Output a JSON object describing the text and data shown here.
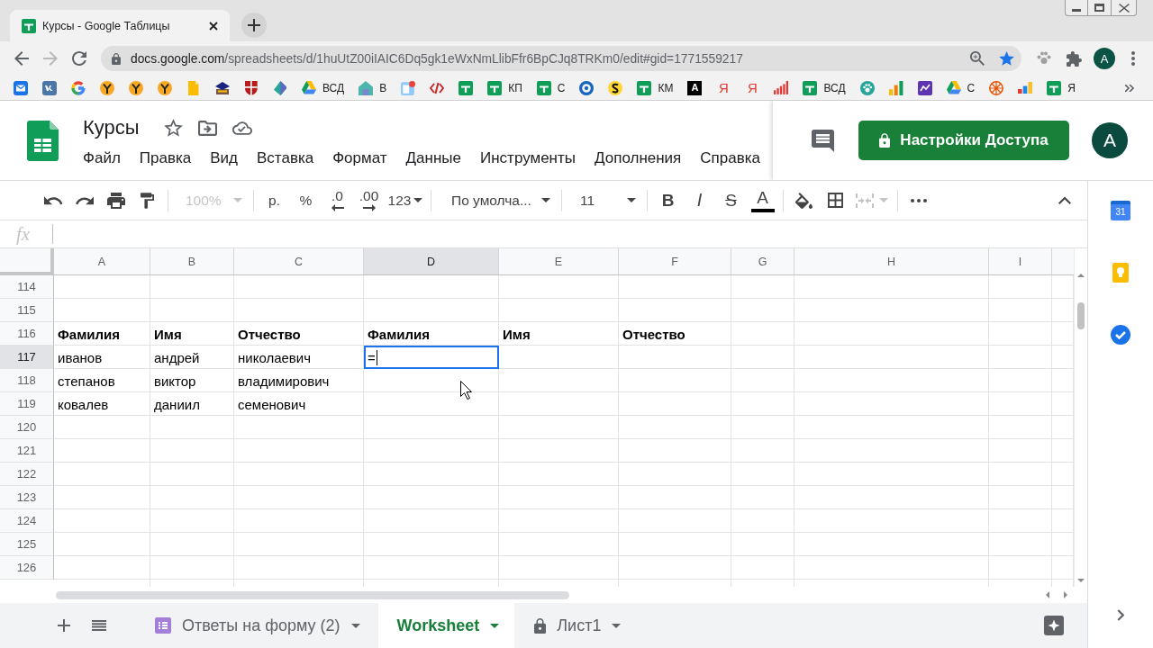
{
  "browser": {
    "tabs": [
      {
        "title": "Курсы - Google Таблицы",
        "selected": true
      }
    ],
    "address": {
      "host": "docs.google.com",
      "path": "/spreadsheets/d/1huUtZ00iIAIC6Dq5gk1eWxNmLlibFfr6BpCJq8TRKm0/edit#gid=1771559217"
    },
    "bookmarked": true,
    "profile": "A",
    "bookmarks": [
      {
        "kind": "mail"
      },
      {
        "kind": "vk"
      },
      {
        "kind": "google"
      },
      {
        "kind": "figure"
      },
      {
        "kind": "figure"
      },
      {
        "kind": "figure"
      },
      {
        "kind": "note"
      },
      {
        "kind": "cap"
      },
      {
        "kind": "crest"
      },
      {
        "kind": "leaf"
      },
      {
        "kind": "drive",
        "label": "ВСД"
      },
      {
        "kind": "house",
        "label": "В"
      },
      {
        "kind": "contact"
      },
      {
        "kind": "code"
      },
      {
        "kind": "sheets"
      },
      {
        "kind": "sheets",
        "label": "КП"
      },
      {
        "kind": "sheets",
        "label": "С"
      },
      {
        "kind": "ring"
      },
      {
        "kind": "coin"
      },
      {
        "kind": "sheets",
        "label": "КМ"
      },
      {
        "kind": "letter-tile",
        "glyph": "A"
      },
      {
        "kind": "ya",
        "glyph": "Я"
      },
      {
        "kind": "ya",
        "glyph": "Я"
      },
      {
        "kind": "bars-red"
      },
      {
        "kind": "sheets",
        "label": "ВСД"
      },
      {
        "kind": "paw"
      },
      {
        "kind": "bars-green"
      },
      {
        "kind": "purple"
      },
      {
        "kind": "drive",
        "label": "С"
      },
      {
        "kind": "wheel"
      },
      {
        "kind": "bars-color"
      },
      {
        "kind": "sheets",
        "label": "Я"
      }
    ]
  },
  "document": {
    "title": "Курсы",
    "starred": false,
    "menu": [
      "Файл",
      "Правка",
      "Вид",
      "Вставка",
      "Формат",
      "Данные",
      "Инструменты",
      "Дополнения",
      "Справка"
    ],
    "share_button": "Настройки Доступа",
    "avatar": "A"
  },
  "toolbar": {
    "groups": [
      [
        {
          "kind": "undo",
          "disabled": false
        },
        {
          "kind": "redo",
          "disabled": false
        },
        {
          "kind": "print",
          "disabled": false
        },
        {
          "kind": "paint-format",
          "disabled": false
        }
      ],
      [
        {
          "kind": "zoom",
          "label": "100%",
          "disabled": true
        }
      ],
      [
        {
          "kind": "currency",
          "label": "р.",
          "disabled": false
        },
        {
          "kind": "percent",
          "label": "%",
          "disabled": false
        },
        {
          "kind": "decimal-less",
          "label": ".0",
          "disabled": false
        },
        {
          "kind": "decimal-more",
          "label": ".00",
          "disabled": false
        },
        {
          "kind": "number-format",
          "label": "123",
          "disabled": false
        }
      ],
      [
        {
          "kind": "font",
          "label": "По умолча...",
          "disabled": false
        }
      ],
      [
        {
          "kind": "font-size",
          "label": "11",
          "disabled": false
        }
      ],
      [
        {
          "kind": "bold",
          "label": "B",
          "disabled": false
        },
        {
          "kind": "italic",
          "label": "I",
          "disabled": false
        },
        {
          "kind": "strike",
          "label": "S",
          "disabled": false
        },
        {
          "kind": "text-color",
          "label": "A",
          "color": "#000000",
          "disabled": false
        }
      ],
      [
        {
          "kind": "fill",
          "disabled": false
        },
        {
          "kind": "borders",
          "disabled": false
        },
        {
          "kind": "merge",
          "disabled": true
        }
      ],
      [
        {
          "kind": "more",
          "disabled": false
        }
      ]
    ]
  },
  "formula_bar": {
    "label": "fx"
  },
  "grid": {
    "columns": [
      {
        "label": "A",
        "selected": false
      },
      {
        "label": "B",
        "selected": false
      },
      {
        "label": "C",
        "selected": false
      },
      {
        "label": "D",
        "selected": true
      },
      {
        "label": "E",
        "selected": false
      },
      {
        "label": "F",
        "selected": false
      },
      {
        "label": "G",
        "selected": false
      },
      {
        "label": "H",
        "selected": false
      },
      {
        "label": "I",
        "selected": false
      }
    ],
    "rows": [
      {
        "number": "114",
        "selected": false
      },
      {
        "number": "115",
        "selected": false
      },
      {
        "number": "116",
        "selected": false,
        "bold": true,
        "cells": [
          "Фамилия",
          "Имя",
          "Отчество",
          "Фамилия",
          "Имя",
          "Отчество"
        ]
      },
      {
        "number": "117",
        "selected": true,
        "bold": false,
        "cells": [
          "иванов",
          "андрей",
          "николаевич",
          "="
        ]
      },
      {
        "number": "118",
        "selected": false,
        "bold": false,
        "cells": [
          "степанов",
          "виктор",
          "владимирович"
        ]
      },
      {
        "number": "119",
        "selected": false,
        "bold": false,
        "cells": [
          "ковалев",
          "даниил",
          "семенович"
        ]
      },
      {
        "number": "120",
        "selected": false
      },
      {
        "number": "121",
        "selected": false
      },
      {
        "number": "122",
        "selected": false
      },
      {
        "number": "123",
        "selected": false
      },
      {
        "number": "124",
        "selected": false
      },
      {
        "number": "125",
        "selected": false
      },
      {
        "number": "126",
        "selected": false
      }
    ]
  },
  "sheets": [
    {
      "label": "Ответы на форму (2)",
      "kind": "form",
      "selected": false
    },
    {
      "label": "Worksheet",
      "kind": "plain",
      "selected": true
    },
    {
      "label": "Лист1",
      "kind": "locked",
      "selected": false
    }
  ],
  "side_panel": {
    "calendar_day": "31"
  }
}
